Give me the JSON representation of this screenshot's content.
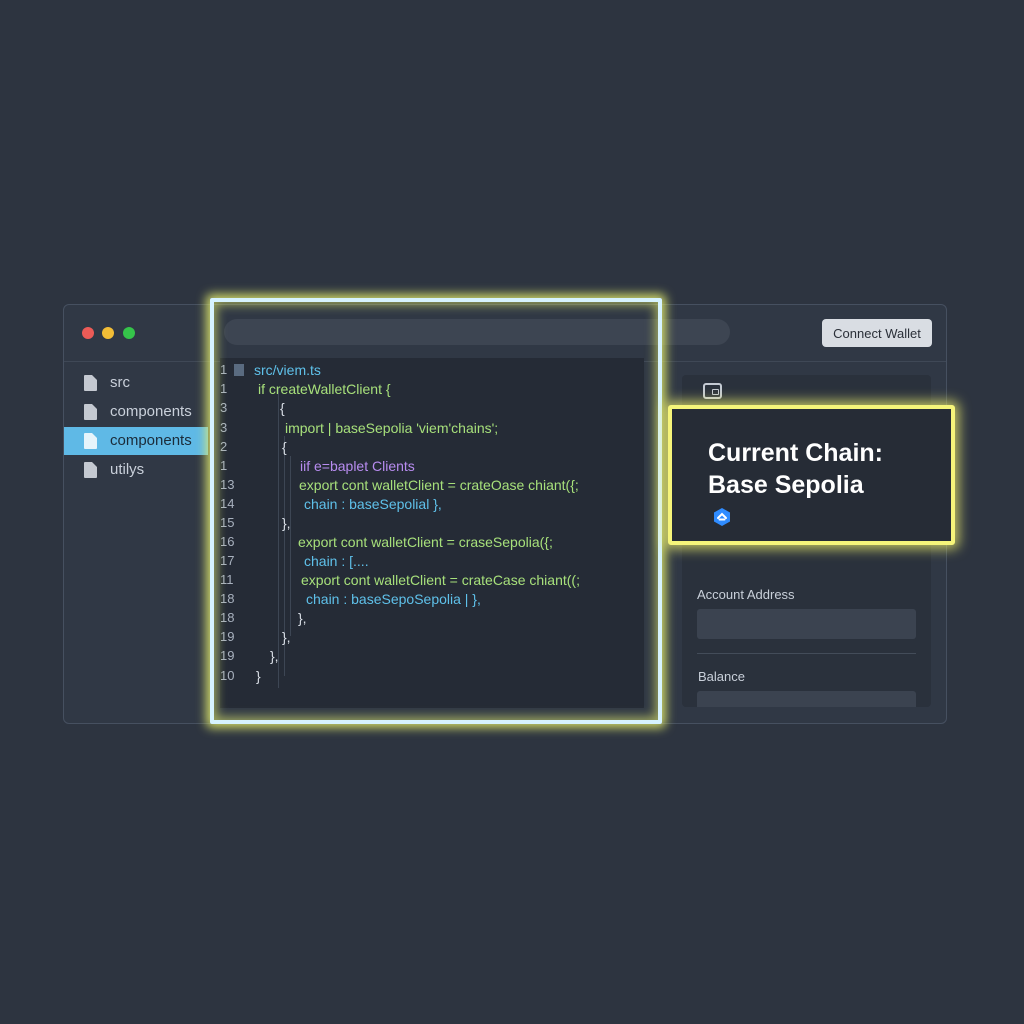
{
  "window": {
    "connect_button": "Connect Wallet"
  },
  "sidebar": {
    "items": [
      {
        "label": "src",
        "active": false
      },
      {
        "label": "components",
        "active": false
      },
      {
        "label": "components",
        "active": true
      },
      {
        "label": "utilys",
        "active": false
      }
    ]
  },
  "editor": {
    "lines": [
      {
        "n": "1",
        "text": "src/viem.ts",
        "color": "blue"
      },
      {
        "n": "1",
        "text": "if createWalletClient {",
        "color": "green"
      },
      {
        "n": "3",
        "text": "{",
        "color": "white"
      },
      {
        "n": "3",
        "text": "import | baseSepolia 'viem'chains';",
        "color": "green"
      },
      {
        "n": "2",
        "text": "{",
        "color": "white"
      },
      {
        "n": "1",
        "text": "iif e=baplet Clients",
        "color": "purple"
      },
      {
        "n": "13",
        "text": "export cont walletClient = crateOase chiant({;",
        "color": "green"
      },
      {
        "n": "14",
        "text": "chain : baseSepolial },",
        "color": "blue"
      },
      {
        "n": "15",
        "text": "},",
        "color": "white"
      },
      {
        "n": "16",
        "text": "export cont walletClient = craseSepolia({;",
        "color": "green"
      },
      {
        "n": "17",
        "text": "chain : [....",
        "color": "blue"
      },
      {
        "n": "11",
        "text": "export cont walletClient = crateCase chiant((;",
        "color": "green"
      },
      {
        "n": "18",
        "text": "chain : baseSepoSepolia | },",
        "color": "blue"
      },
      {
        "n": "18",
        "text": "},",
        "color": "white"
      },
      {
        "n": "19",
        "text": "},",
        "color": "white"
      },
      {
        "n": "19",
        "text": "},",
        "color": "white"
      },
      {
        "n": "10",
        "text": "}",
        "color": "white"
      }
    ]
  },
  "panel": {
    "chain_title_line1": "Current Chain:",
    "chain_title_line2": "Base Sepolia",
    "account_label": "Account Address",
    "balance_label": "Balance"
  },
  "colors": {
    "accent_blue": "#5fb9e6",
    "highlight_yellow": "#f6f57a",
    "chain_icon": "#2f8cff"
  }
}
